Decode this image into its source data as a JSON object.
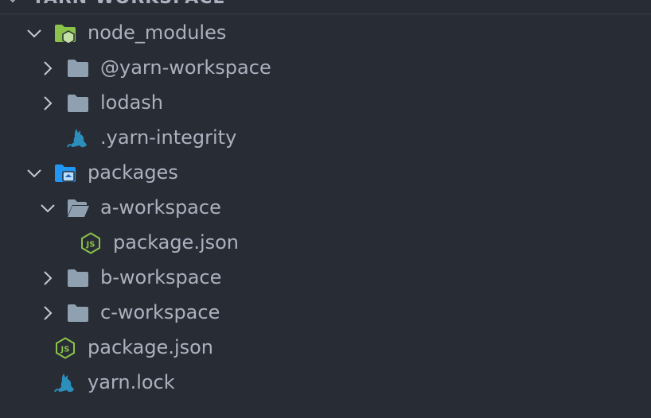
{
  "header": {
    "title": "YARN-WORKSPACE"
  },
  "tree": {
    "items": [
      {
        "label": "node_modules",
        "level": 0,
        "type": "folder-open",
        "expanded": true,
        "icon": "node-modules-folder-icon"
      },
      {
        "label": "@yarn-workspace",
        "level": 1,
        "type": "folder",
        "expanded": false,
        "icon": "folder-icon"
      },
      {
        "label": "lodash",
        "level": 1,
        "type": "folder",
        "expanded": false,
        "icon": "folder-icon"
      },
      {
        "label": ".yarn-integrity",
        "level": 1,
        "type": "file",
        "icon": "yarn-icon"
      },
      {
        "label": "packages",
        "level": 0,
        "type": "folder-open",
        "expanded": true,
        "icon": "packages-folder-icon"
      },
      {
        "label": "a-workspace",
        "level": 1,
        "type": "folder-open",
        "expanded": true,
        "icon": "folder-open-icon"
      },
      {
        "label": "package.json",
        "level": 2,
        "type": "file",
        "icon": "nodejs-icon"
      },
      {
        "label": "b-workspace",
        "level": 1,
        "type": "folder",
        "expanded": false,
        "icon": "folder-icon"
      },
      {
        "label": "c-workspace",
        "level": 1,
        "type": "folder",
        "expanded": false,
        "icon": "folder-icon"
      },
      {
        "label": "package.json",
        "level": 0,
        "type": "file",
        "icon": "nodejs-icon"
      },
      {
        "label": "yarn.lock",
        "level": 0,
        "type": "file",
        "icon": "yarn-icon"
      }
    ]
  },
  "colors": {
    "background": "#282c34",
    "text": "#abb2bf",
    "folder": "#8fa1b0",
    "node_modules_folder": "#8bc34a",
    "packages_folder": "#2196f3",
    "yarn": "#2c8ebb",
    "nodejs": "#8bc34a"
  }
}
